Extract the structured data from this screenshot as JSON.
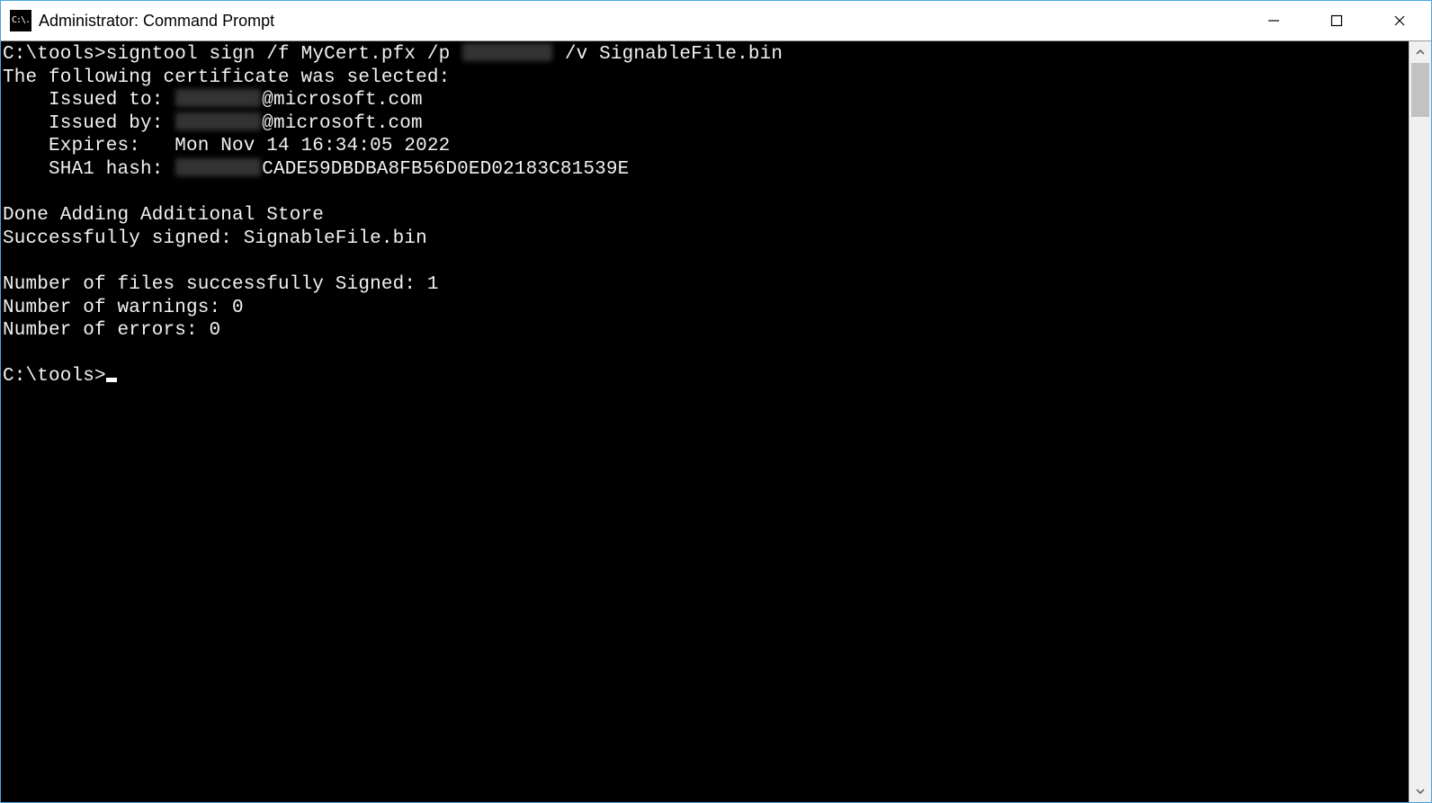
{
  "window": {
    "title": "Administrator: Command Prompt",
    "icon_label": "C:\\."
  },
  "terminal": {
    "cmd_prefix": "C:\\tools>",
    "cmd_part1": "signtool sign /f MyCert.pfx /p ",
    "cmd_part2": " /v SignableFile.bin",
    "cert_selected": "The following certificate was selected:",
    "issued_to_label": "    Issued to: ",
    "issued_to_suffix": "@microsoft.com",
    "issued_by_label": "    Issued by: ",
    "issued_by_suffix": "@microsoft.com",
    "expires_line": "    Expires:   Mon Nov 14 16:34:05 2022",
    "sha1_label": "    SHA1 hash: ",
    "sha1_suffix": "CADE59DBDBA8FB56D0ED02183C81539E",
    "done_store": "Done Adding Additional Store",
    "success_signed": "Successfully signed: SignableFile.bin",
    "num_signed": "Number of files successfully Signed: 1",
    "num_warnings": "Number of warnings: 0",
    "num_errors": "Number of errors: 0",
    "prompt_idle": "C:\\tools>"
  },
  "redact_widths": {
    "password": 100,
    "issued_to": 95,
    "issued_by": 95,
    "sha1": 95
  }
}
